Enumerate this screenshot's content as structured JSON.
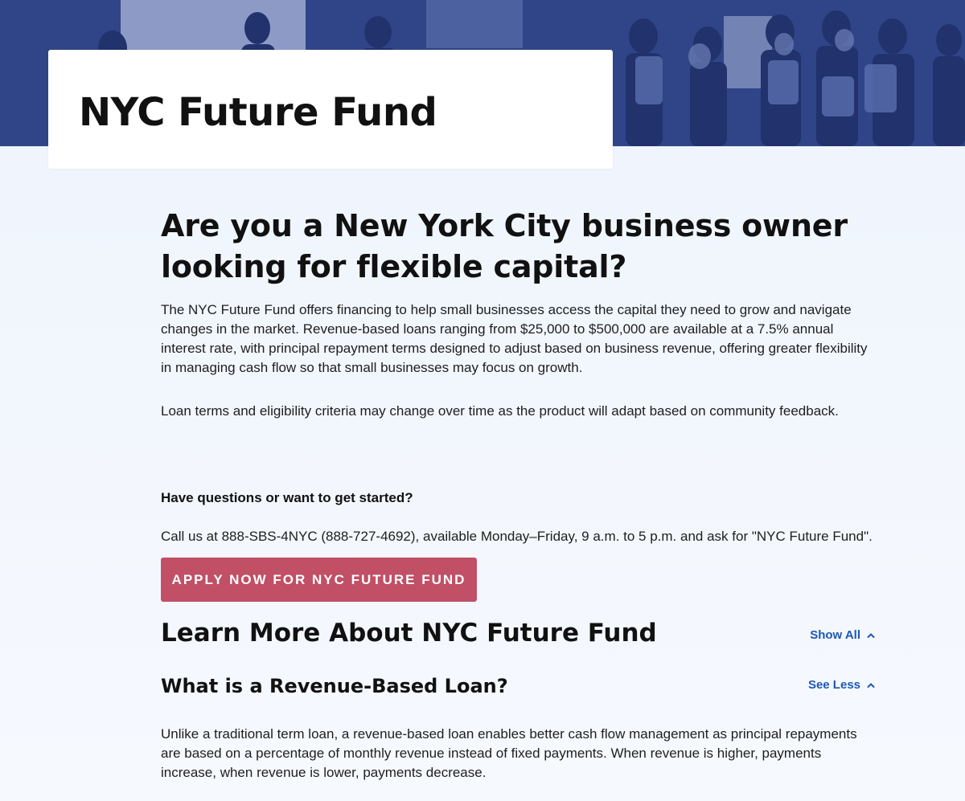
{
  "hero": {
    "title": "NYC Future Fund"
  },
  "main": {
    "heading": "Are you a New York City business owner looking for flexible capital?",
    "intro": "The NYC Future Fund offers financing to help small businesses access the capital they need to grow and navigate changes in the market. Revenue-based loans ranging from $25,000 to $500,000 are available at a 7.5% annual interest rate, with principal repayment terms designed to adjust based on business revenue, offering greater flexibility in managing cash flow so that small businesses may focus on growth.",
    "note": "Loan terms and eligibility criteria may change over time as the product will adapt based on community feedback.",
    "questions_heading": "Have questions or want to get started?",
    "call_text": "Call us at 888-SBS-4NYC (888-727-4692), available Monday–Friday, 9 a.m. to 5 p.m. and ask for \"NYC Future Fund\".",
    "apply_button": "APPLY NOW FOR NYC FUTURE FUND"
  },
  "learn_more": {
    "title": "Learn More About NYC Future Fund",
    "toggle_label": "Show All",
    "toggle_icon": "chevron-up-icon",
    "sections": [
      {
        "title": "What is a Revenue-Based Loan?",
        "toggle_label": "See Less",
        "toggle_icon": "chevron-up-icon",
        "body": "Unlike a traditional term loan, a revenue-based loan enables better cash flow management as principal repayments are based on a percentage of monthly revenue instead of fixed payments. When revenue is higher, payments increase, when revenue is lower, payments decrease."
      }
    ]
  },
  "colors": {
    "accent_button": "#c14f66",
    "link": "#1d57b5",
    "background": "#eef4fd"
  }
}
